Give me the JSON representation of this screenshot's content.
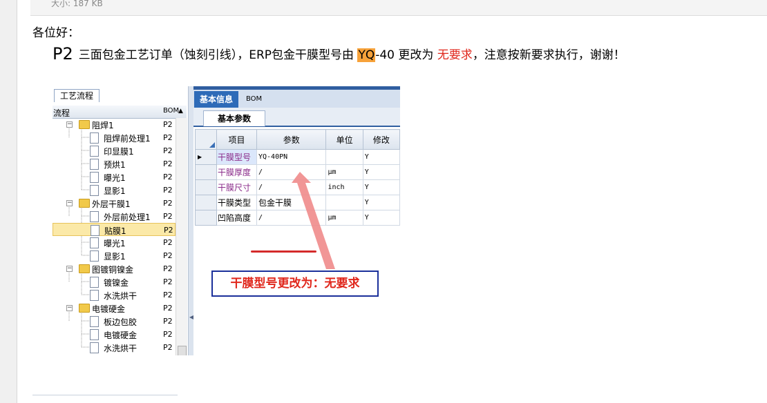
{
  "mail": {
    "attachment_size": "大小: 187 KB",
    "greeting": "各位好：",
    "notice": {
      "prefix": "P2",
      "part1": "三面包金工艺订单（蚀刻引线），ERP包金干膜型号由",
      "highlight": "YQ",
      "part2": "-40 更改为",
      "red": "无要求",
      "part3": "，注意按新要求执行，谢谢！"
    },
    "colors": {
      "highlight": "#f7a23a",
      "red_text": "#e0261b",
      "callout_border": "#1a2f9a",
      "active_tab": "#2e6bb8"
    }
  },
  "screenshot": {
    "tree": {
      "tab_label": "工艺流程",
      "header_flow": "流程",
      "header_code": "BOM",
      "rows": [
        {
          "label": "阻焊1",
          "code": "P2",
          "type": "folder",
          "level": 0
        },
        {
          "label": "阻焊前处理1",
          "code": "P2",
          "type": "doc",
          "level": 1
        },
        {
          "label": "印显膜1",
          "code": "P2",
          "type": "doc",
          "level": 1
        },
        {
          "label": "预烘1",
          "code": "P2",
          "type": "doc",
          "level": 1
        },
        {
          "label": "曝光1",
          "code": "P2",
          "type": "doc",
          "level": 1
        },
        {
          "label": "显影1",
          "code": "P2",
          "type": "doc",
          "level": 1
        },
        {
          "label": "外层干膜1",
          "code": "P2",
          "type": "folder",
          "level": 0
        },
        {
          "label": "外层前处理1",
          "code": "P2",
          "type": "doc",
          "level": 1
        },
        {
          "label": "贴膜1",
          "code": "P2",
          "type": "doc",
          "level": 1,
          "selected": true
        },
        {
          "label": "曝光1",
          "code": "P2",
          "type": "doc",
          "level": 1
        },
        {
          "label": "显影1",
          "code": "P2",
          "type": "doc",
          "level": 1
        },
        {
          "label": "图镀铜镍金",
          "code": "P2",
          "type": "folder",
          "level": 0
        },
        {
          "label": "镀镍金",
          "code": "P2",
          "type": "doc",
          "level": 1
        },
        {
          "label": "水洗烘干",
          "code": "P2",
          "type": "doc",
          "level": 1
        },
        {
          "label": "电镀硬金",
          "code": "P2",
          "type": "folder",
          "level": 0
        },
        {
          "label": "板边包胶",
          "code": "P2",
          "type": "doc",
          "level": 1
        },
        {
          "label": "电镀硬金",
          "code": "P2",
          "type": "doc",
          "level": 1
        },
        {
          "label": "水洗烘干",
          "code": "P2",
          "type": "doc",
          "level": 1
        }
      ]
    },
    "tabs": {
      "basic_info": "基本信息",
      "bom": "BOM",
      "sub_tab": "基本参数"
    },
    "grid": {
      "headers": {
        "item": "项目",
        "param": "参数",
        "unit": "单位",
        "modify": "修改"
      },
      "rows": [
        {
          "item": "干膜型号",
          "param": "YQ-40PN",
          "unit": "",
          "modify": "Y"
        },
        {
          "item": "干膜厚度",
          "param": "/",
          "unit": "μm",
          "modify": "Y"
        },
        {
          "item": "干膜尺寸",
          "param": "/",
          "unit": "inch",
          "modify": "Y"
        },
        {
          "item": "干膜类型",
          "param": "包金干膜",
          "unit": "",
          "modify": "Y"
        },
        {
          "item": "凹陷高度",
          "param": "/",
          "unit": "μm",
          "modify": "Y"
        }
      ]
    },
    "callout": "干膜型号更改为：无要求"
  }
}
